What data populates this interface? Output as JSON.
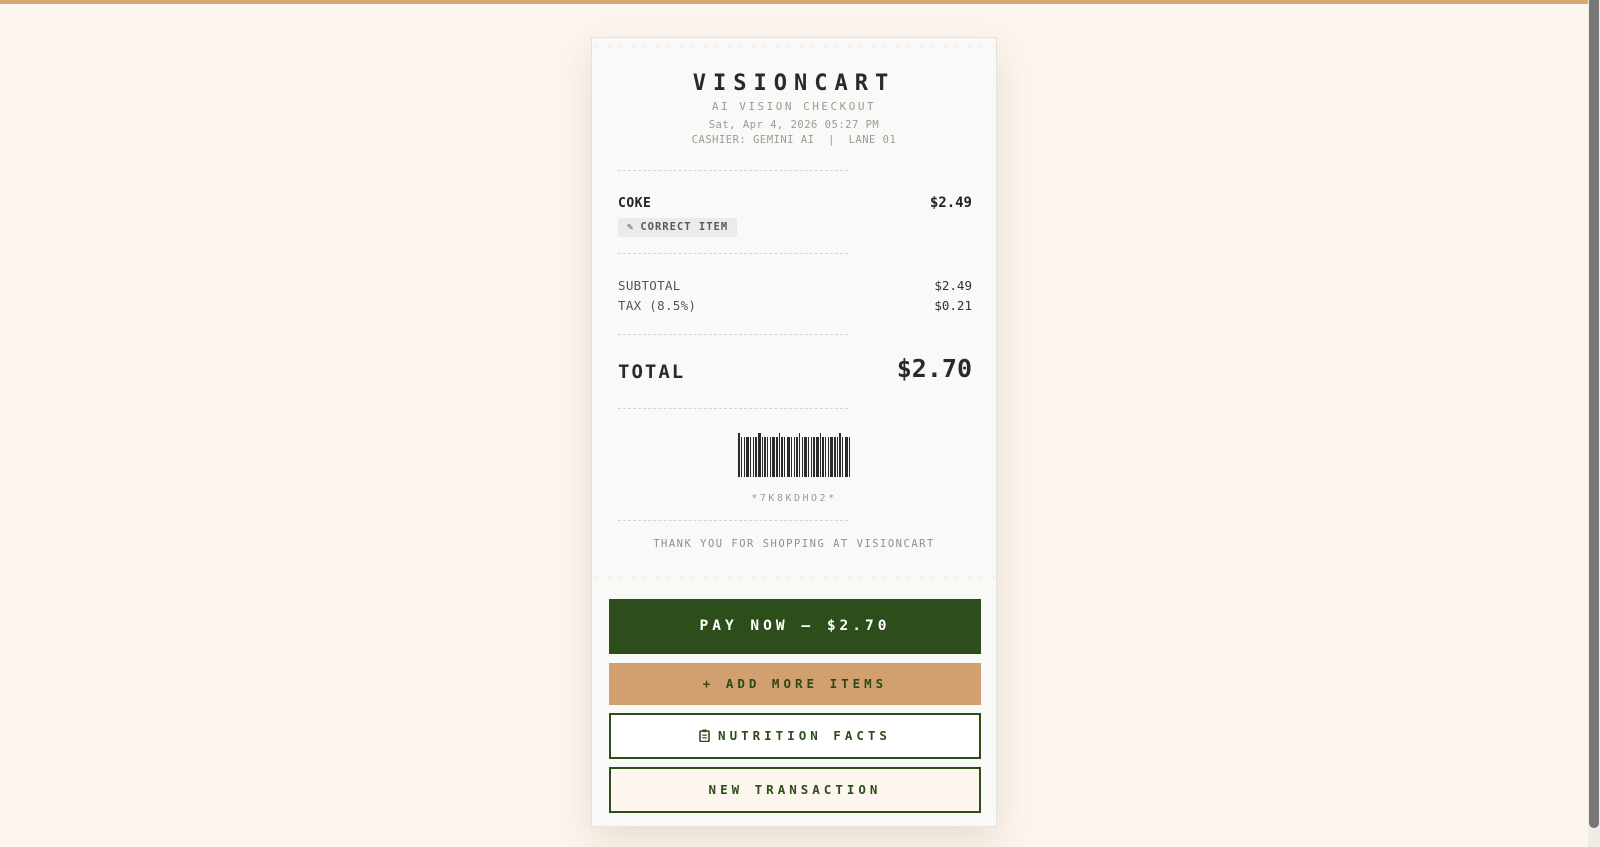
{
  "store": {
    "brand": "VISIONCART",
    "subtitle": "AI VISION CHECKOUT",
    "datetime": "Sat, Apr 4, 2026 05:27 PM",
    "cashier_line": "CASHIER: GEMINI AI  |  LANE 01"
  },
  "items": [
    {
      "name": "COKE",
      "price": "$2.49",
      "correct_label": "CORRECT ITEM",
      "correct_icon": "pencil-icon"
    }
  ],
  "summary": {
    "subtotal_label": "SUBTOTAL",
    "subtotal_value": "$2.49",
    "tax_label": "TAX (8.5%)",
    "tax_value": "$0.21",
    "total_label": "TOTAL",
    "total_value": "$2.70"
  },
  "barcode_text": "*7K8KDHO2*",
  "thanks": "THANK YOU FOR SHOPPING AT VISIONCART",
  "actions": {
    "pay": "PAY NOW — $2.70",
    "add_more": "+ ADD MORE ITEMS",
    "nutrition": "NUTRITION FACTS",
    "nutrition_icon": "clipboard-icon",
    "new_transaction": "NEW TRANSACTION"
  },
  "colors": {
    "background": "#fdf6ee",
    "accent_green": "#2d4d1a",
    "accent_tan": "#d2a06f",
    "top_bar": "#d8a66e"
  }
}
